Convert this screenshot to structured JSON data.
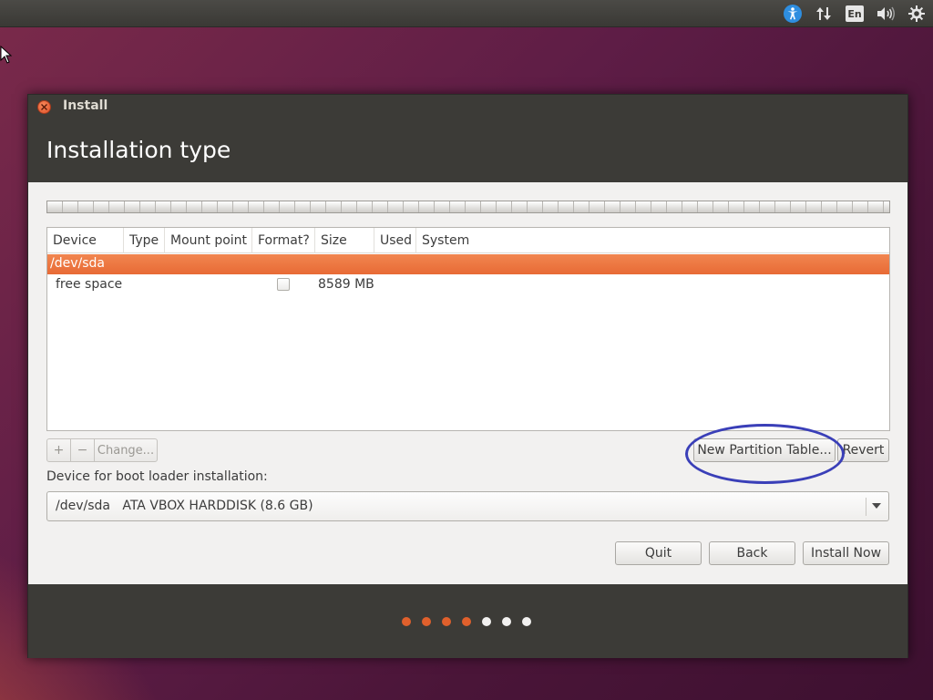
{
  "panel": {
    "language": "En",
    "icons": [
      "accessibility-icon",
      "network-icon",
      "keyboard-language-indicator",
      "volume-icon",
      "settings-gear-icon"
    ]
  },
  "window": {
    "title": "Install",
    "page_title": "Installation type"
  },
  "table": {
    "columns": [
      "Device",
      "Type",
      "Mount point",
      "Format?",
      "Size",
      "Used",
      "System"
    ],
    "selected_row": {
      "device": "/dev/sda"
    },
    "rows": [
      {
        "device": "free space",
        "type": "",
        "mount_point": "",
        "format": false,
        "size": "8589 MB",
        "used": "",
        "system": ""
      }
    ]
  },
  "actions": {
    "add": "+",
    "remove": "−",
    "change": "Change...",
    "new_partition_table": "New Partition Table...",
    "revert": "Revert"
  },
  "boot_loader": {
    "label": "Device for boot loader installation:",
    "device": "/dev/sda",
    "description": "ATA VBOX HARDDISK (8.6 GB)"
  },
  "nav": {
    "quit": "Quit",
    "back": "Back",
    "install_now": "Install Now"
  },
  "progress": {
    "total_steps": 7,
    "completed_steps": 4,
    "active_color": "#e0602c",
    "inactive_color": "#f2f1f0"
  },
  "colors": {
    "accent": "#e86a35",
    "highlight_ellipse": "#3a3fb8"
  }
}
